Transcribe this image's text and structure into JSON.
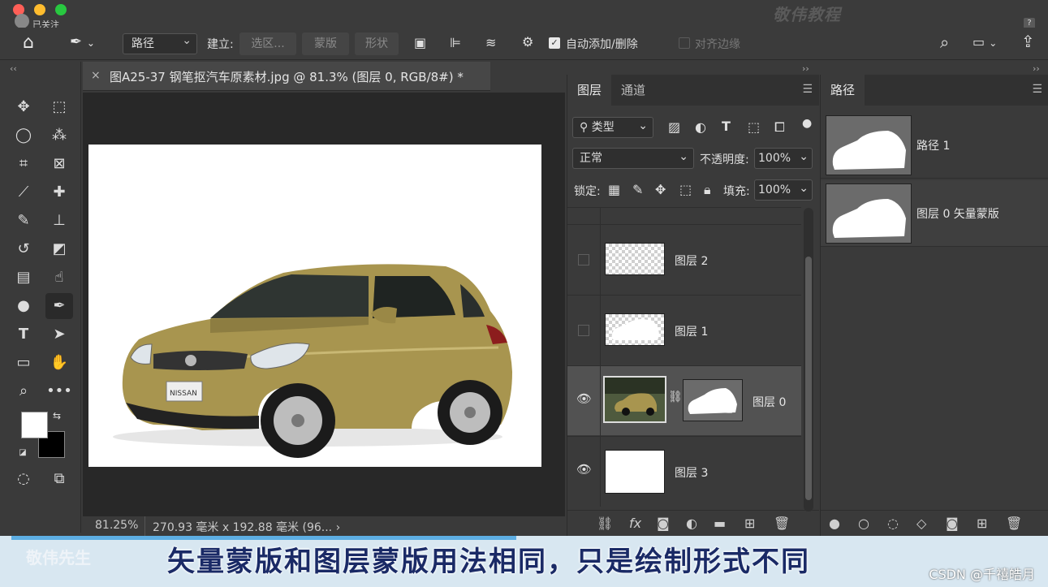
{
  "mac": {
    "follow_label": "已关注",
    "watermark": "敬伟教程",
    "help": "?"
  },
  "options": {
    "mode_select": "路径",
    "make_label": "建立:",
    "btn_selection": "选区...",
    "btn_mask": "蒙版",
    "btn_shape": "形状",
    "auto_add_delete": "自动添加/删除",
    "align_edges": "对齐边缘"
  },
  "document": {
    "tab_title": "图A25-37 钢笔抠汽车原素材.jpg @ 81.3% (图层 0, RGB/8#) *",
    "zoom": "81.25%",
    "dimensions": "270.93 毫米 x 192.88 毫米 (96... ›"
  },
  "layers_panel": {
    "tabs": [
      "图层",
      "通道"
    ],
    "filter_select": "类型",
    "blend_mode": "正常",
    "opacity_label": "不透明度:",
    "opacity_value": "100%",
    "lock_label": "锁定:",
    "fill_label": "填充:",
    "fill_value": "100%",
    "layers": [
      {
        "name": "图层 2",
        "visible": false
      },
      {
        "name": "图层 1",
        "visible": false
      },
      {
        "name": "图层 0",
        "visible": true,
        "selected": true
      },
      {
        "name": "图层 3",
        "visible": true
      }
    ]
  },
  "paths_panel": {
    "tab": "路径",
    "paths": [
      {
        "name": "路径 1"
      },
      {
        "name": "图层 0 矢量蒙版"
      }
    ]
  },
  "subtitle": {
    "text": "矢量蒙版和图层蒙版用法相同，只是绘制形式不同",
    "watermark": "敬伟先生",
    "credit": "CSDN @千禧皓月"
  },
  "colors": {
    "panel": "#3a3a3a",
    "canvas_bg": "#282828",
    "car_body": "#a8954f",
    "subtitle_text": "#1a2a66"
  }
}
